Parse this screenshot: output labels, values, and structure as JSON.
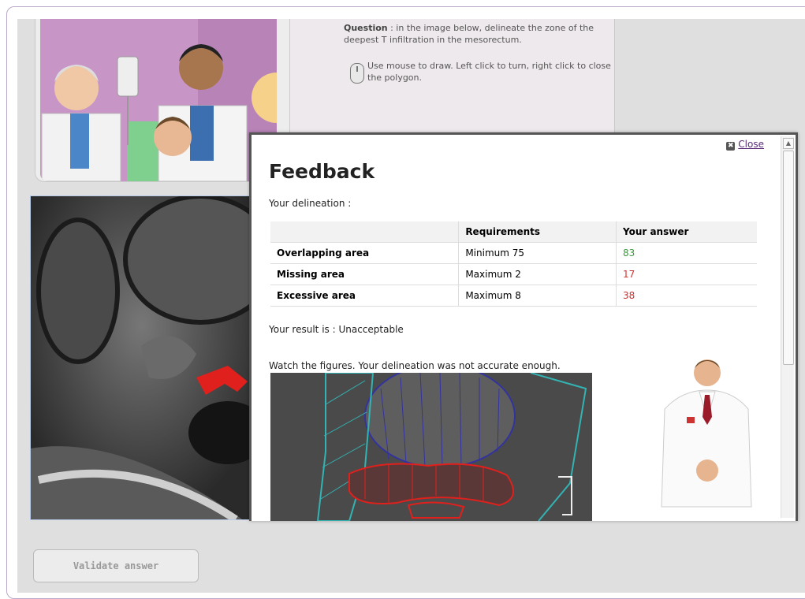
{
  "question": {
    "label": "Question",
    "text": " : in the image below, delineate the zone of the deepest T infiltration in the mesorectum.",
    "instruction": "Use mouse to draw. Left click to turn, right click to close the polygon."
  },
  "feedback": {
    "close_label": "Close",
    "title": "Feedback",
    "subtitle": "Your delineation :",
    "table": {
      "headers": [
        "",
        "Requirements",
        "Your answer"
      ],
      "rows": [
        {
          "label": "Overlapping area",
          "requirement": "Minimum 75",
          "answer": "83"
        },
        {
          "label": "Missing area",
          "requirement": "Maximum 2",
          "answer": "17"
        },
        {
          "label": "Excessive area",
          "requirement": "Maximum 8",
          "answer": "38"
        }
      ]
    },
    "result": "Your result is : Unacceptable",
    "watch_text": "Watch the figures. Your delineation was not accurate enough."
  },
  "validate_label": "Validate answer",
  "colors": {
    "answer_ok": "#3a9a3a",
    "answer_bad": "#d03030",
    "delineation": "#e0201c",
    "mesorectum_outline": "#33b3b3",
    "bladder_outline": "#3333a0"
  },
  "icons": [
    "mouse-icon",
    "close-icon",
    "scroll-up-icon"
  ]
}
